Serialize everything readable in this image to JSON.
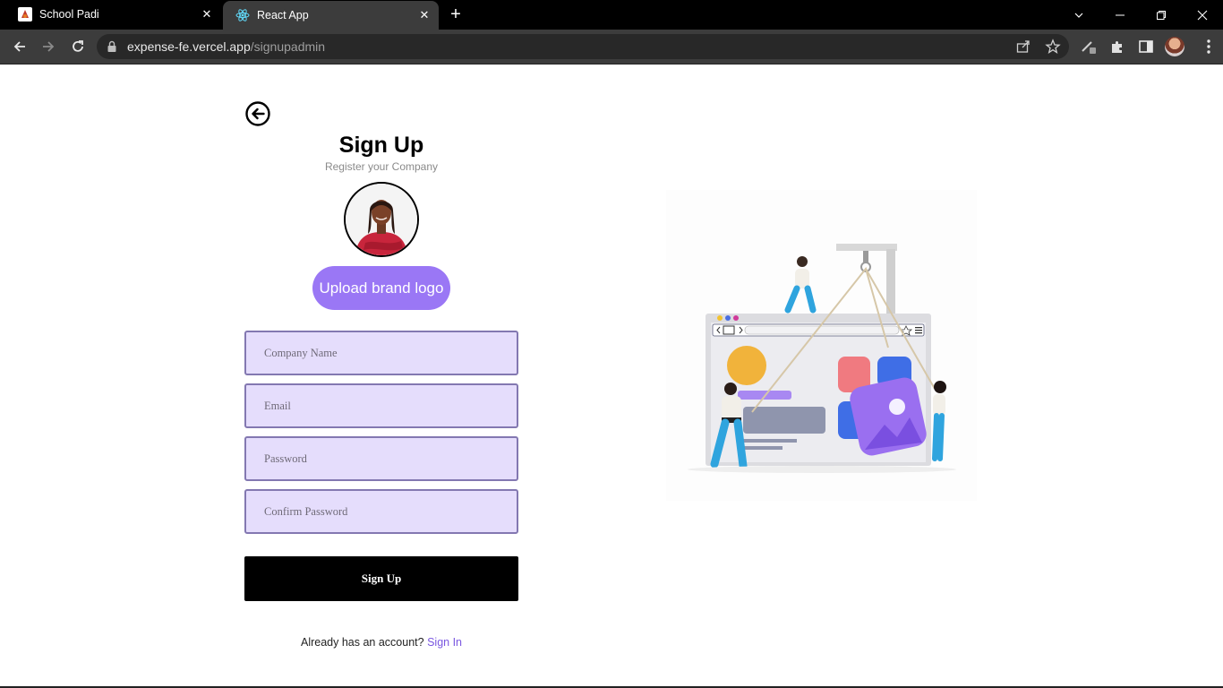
{
  "browser": {
    "tabs": [
      {
        "title": "School Padi",
        "active": false,
        "favicon": "school-padi-favicon"
      },
      {
        "title": "React App",
        "active": true,
        "favicon": "react-favicon"
      }
    ],
    "url_host": "expense-fe.vercel.app",
    "url_path": "/signupadmin"
  },
  "page": {
    "title": "Sign Up",
    "subtitle": "Register your Company",
    "upload_label": "Upload brand logo",
    "fields": {
      "company_placeholder": "Company Name",
      "email_placeholder": "Email",
      "password_placeholder": "Password",
      "confirm_placeholder": "Confirm Password"
    },
    "submit_label": "Sign Up",
    "footer_prompt": "Already has an account?",
    "footer_link": "Sign In"
  },
  "colors": {
    "accent": "#9a77f5",
    "field_bg": "#e5ddfc",
    "field_border": "#8378b1",
    "link": "#7a57e0",
    "submit_bg": "#000000"
  }
}
